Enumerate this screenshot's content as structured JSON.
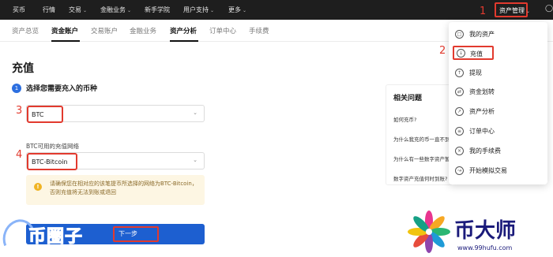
{
  "topnav": {
    "items": [
      "买币",
      "行情",
      "交易",
      "金融业务",
      "新手学院",
      "用户支持",
      "更多"
    ],
    "asset_mgmt": "资产管理",
    "user_icon": "user-icon"
  },
  "subnav": {
    "tabs": [
      "资产总览",
      "资金账户",
      "交易账户",
      "金融业务",
      "资产分析",
      "订单中心",
      "手续费"
    ]
  },
  "page": {
    "title": "充值",
    "step_number": "1",
    "step_text": "选择您需要充入的币种",
    "coin_value": "BTC",
    "network_label": "BTC可用的充值网络",
    "network_value": "BTC-Bitcoin",
    "warning": "请确保您在相对应的该笔提币所选择的网络为BTC-Bitcoin，否则充值将无法到账或退回",
    "next_button": "下一步"
  },
  "faq": {
    "title": "相关问题",
    "questions": [
      "如何充币?",
      "为什么我充的币一直不到账?",
      "为什么有一些数字资产暂停充值?",
      "数字资产充值何时到账?"
    ]
  },
  "dropdown": {
    "items": [
      {
        "label": "我的资产",
        "icon": "wallet-icon"
      },
      {
        "label": "充值",
        "icon": "deposit-icon"
      },
      {
        "label": "提现",
        "icon": "withdraw-icon"
      },
      {
        "label": "资金划转",
        "icon": "transfer-icon"
      },
      {
        "label": "资产分析",
        "icon": "analysis-icon"
      },
      {
        "label": "订单中心",
        "icon": "order-icon"
      },
      {
        "label": "我的手续费",
        "icon": "fee-icon"
      },
      {
        "label": "开始模拟交易",
        "icon": "simulate-icon"
      }
    ]
  },
  "annotations": [
    "1",
    "2",
    "3",
    "4"
  ],
  "watermarks": {
    "left": "币圈子",
    "right_name": "币大师",
    "right_url": "www.99hufu.com"
  },
  "colors": {
    "accent": "#1d5fd0",
    "highlight": "#e23a2e",
    "nav_bg": "#1e1e1e",
    "warning_bg": "#fdf6e3"
  }
}
